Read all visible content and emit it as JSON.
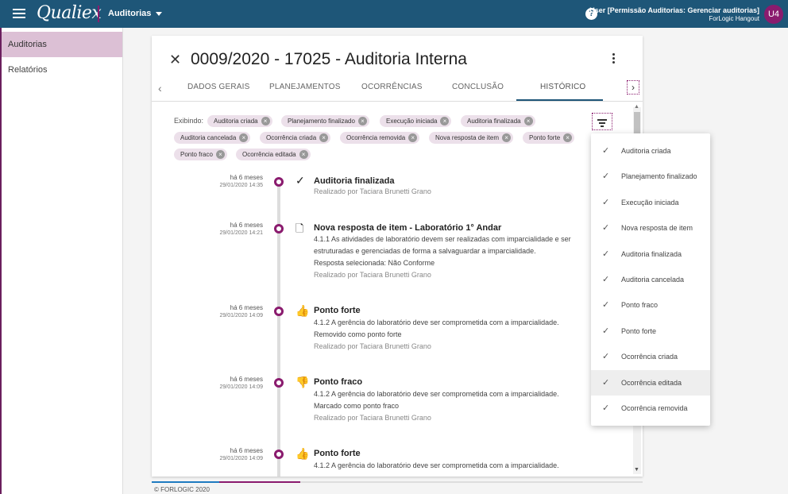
{
  "topbar": {
    "logo": "Qualiex",
    "module": "Auditorias",
    "help": "?",
    "user_name": "User [Permissão Auditorias: Gerenciar auditorias]",
    "user_company": "ForLogic Hangout",
    "avatar": "U4"
  },
  "sidebar": {
    "items": [
      {
        "label": "Auditorias"
      },
      {
        "label": "Relatórios"
      }
    ]
  },
  "card": {
    "title": "0009/2020 - 17025 - Auditoria Interna",
    "close": "✕",
    "tabs": [
      "DADOS GERAIS",
      "PLANEJAMENTOS",
      "OCORRÊNCIAS",
      "CONCLUSÃO",
      "HISTÓRICO"
    ],
    "active_tab": "HISTÓRICO"
  },
  "filters": {
    "label": "Exibindo:",
    "chips": [
      "Auditoria criada",
      "Planejamento finalizado",
      "Execução iniciada",
      "Auditoria finalizada",
      "Auditoria cancelada",
      "Ocorrência criada",
      "Ocorrência removida",
      "Nova resposta de item",
      "Ponto forte",
      "Ponto fraco",
      "Ocorrência editada"
    ]
  },
  "timeline": [
    {
      "when": "há 6 meses",
      "date": "29/01/2020 14:35",
      "icon": "check-icon",
      "title": "Auditoria finalizada",
      "lines": [],
      "meta": "Realizado por Taciara Brunetti Grano"
    },
    {
      "when": "há 6 meses",
      "date": "29/01/2020 14:21",
      "icon": "new-file-icon",
      "title": "Nova resposta de item - Laboratório 1° Andar",
      "lines": [
        "4.1.1 As atividades de laboratório devem ser realizadas com imparcialidade e ser estruturadas e gerenciadas de forma a salvaguardar a imparcialidade.",
        "Resposta selecionada: Não Conforme"
      ],
      "meta": "Realizado por Taciara Brunetti Grano"
    },
    {
      "when": "há 6 meses",
      "date": "29/01/2020 14:09",
      "icon": "thumbs-up-icon",
      "title": "Ponto forte",
      "lines": [
        "4.1.2 A gerência do laboratório deve ser comprometida com a imparcialidade.",
        "Removido como ponto forte"
      ],
      "meta": "Realizado por Taciara Brunetti Grano"
    },
    {
      "when": "há 6 meses",
      "date": "29/01/2020 14:09",
      "icon": "thumbs-down-icon",
      "title": "Ponto fraco",
      "lines": [
        "4.1.2 A gerência do laboratório deve ser comprometida com a imparcialidade.",
        "Marcado como ponto fraco"
      ],
      "meta": "Realizado por Taciara Brunetti Grano"
    },
    {
      "when": "há 6 meses",
      "date": "29/01/2020 14:09",
      "icon": "thumbs-up-icon",
      "title": "Ponto forte",
      "lines": [
        "4.1.2 A gerência do laboratório deve ser comprometida com a imparcialidade."
      ],
      "meta": ""
    }
  ],
  "dropdown": {
    "items": [
      "Auditoria criada",
      "Planejamento finalizado",
      "Execução iniciada",
      "Nova resposta de item",
      "Auditoria finalizada",
      "Auditoria cancelada",
      "Ponto fraco",
      "Ponto forte",
      "Ocorrência criada",
      "Ocorrência editada",
      "Ocorrência removida"
    ],
    "hovered": "Ocorrência editada"
  },
  "footer": {
    "text": "© FORLOGIC 2020"
  },
  "colors": {
    "topbar": "#1e5678",
    "accent": "#8a1b6e",
    "sidebar_active": "#dcc0d5",
    "chip": "#ece0ea"
  }
}
